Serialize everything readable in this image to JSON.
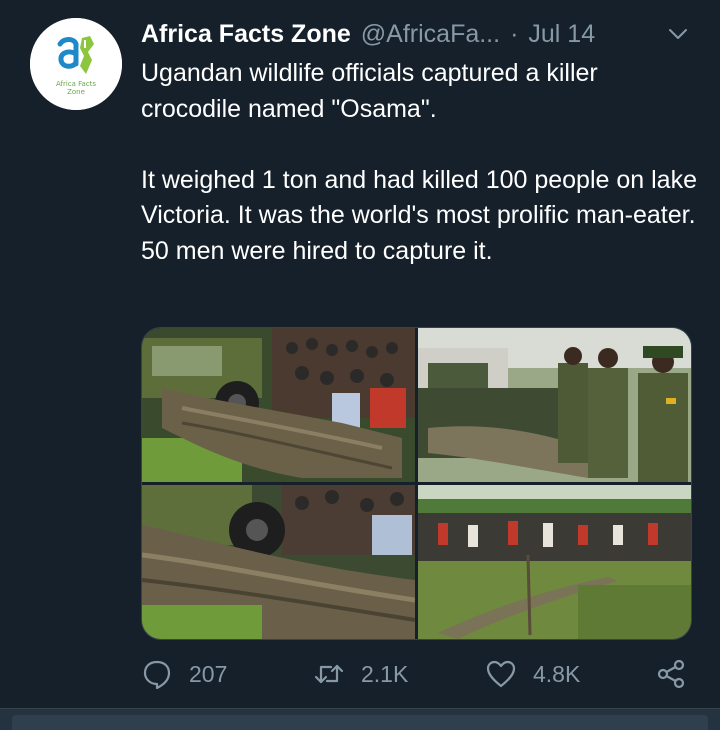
{
  "tweet": {
    "display_name": "Africa Facts Zone",
    "handle": "@AfricaFa...",
    "separator": "·",
    "date": "Jul 14",
    "avatar": {
      "logo_text": "Africa Facts Zone",
      "colors": {
        "blue": "#1e88c9",
        "green": "#8cc63f"
      }
    },
    "text_paragraphs": [
      "Ugandan wildlife officials captured a killer crocodile named \"Osama\".",
      "It weighed 1 ton and had killed 100 people on lake Victoria. It was the world's most prolific man-eater. 50 men were hired to capture it."
    ],
    "media": [
      {
        "icon": "photo",
        "subject": "crocodile-on-truck-crowd"
      },
      {
        "icon": "photo",
        "subject": "rangers-with-crocodile-truck"
      },
      {
        "icon": "photo",
        "subject": "crocodile-closeup-ropes"
      },
      {
        "icon": "photo",
        "subject": "crocodile-on-grass-crowd"
      }
    ],
    "actions": {
      "reply": {
        "icon": "reply-icon",
        "count": "207"
      },
      "retweet": {
        "icon": "retweet-icon",
        "count": "2.1K"
      },
      "like": {
        "icon": "heart-icon",
        "count": "4.8K"
      },
      "share": {
        "icon": "share-icon"
      }
    }
  },
  "theme": {
    "background": "#15202b",
    "text_primary": "#ffffff",
    "text_secondary": "#8899a6",
    "border": "#38444d"
  }
}
